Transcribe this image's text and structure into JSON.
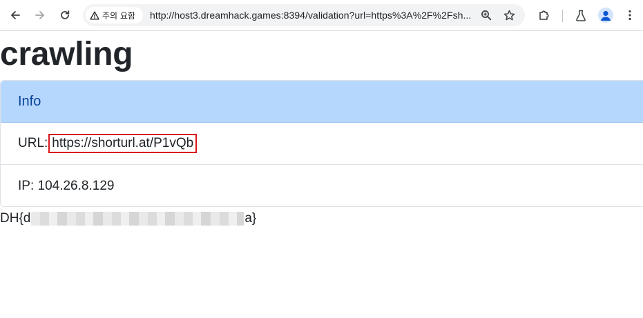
{
  "browser": {
    "security_chip": "주의 요함",
    "url": "http://host3.dreamhack.games:8394/validation?url=https%3A%2F%2Fsh..."
  },
  "page": {
    "title": "crawling",
    "card": {
      "header": "Info",
      "url_label": "URL:",
      "url_value": "https://shorturl.at/P1vQb",
      "ip_text": "IP: 104.26.8.129"
    },
    "flag_prefix": "DH{d",
    "flag_suffix": "a}"
  },
  "colors": {
    "card_header_bg": "#b6d7fd",
    "card_header_text": "#084298",
    "highlight_box": "#d9161b"
  },
  "icons": [
    "back-arrow-icon",
    "forward-arrow-icon",
    "reload-icon",
    "warning-icon",
    "zoom-icon",
    "bookmark-star-icon",
    "extensions-icon",
    "labs-flask-icon",
    "profile-avatar-icon",
    "more-menu-icon"
  ]
}
